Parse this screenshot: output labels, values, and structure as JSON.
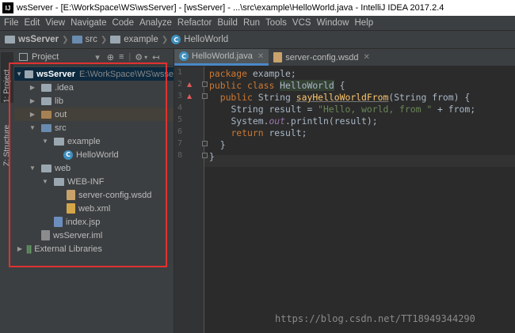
{
  "window": {
    "title": "wsServer - [E:\\WorkSpace\\WS\\wsServer] - [wsServer] - ...\\src\\example\\HelloWorld.java - IntelliJ IDEA 2017.2.4"
  },
  "menu": [
    "File",
    "Edit",
    "View",
    "Navigate",
    "Code",
    "Analyze",
    "Refactor",
    "Build",
    "Run",
    "Tools",
    "VCS",
    "Window",
    "Help"
  ],
  "breadcrumb": {
    "project": "wsServer",
    "folder1": "src",
    "folder2": "example",
    "file": "HelloWorld"
  },
  "side_tabs": {
    "project": "1: Project",
    "structure": "Z: Structure"
  },
  "project_panel": {
    "view_selector": "Project",
    "tree": [
      {
        "label": "wsServer",
        "path": "E:\\WorkSpace\\WS\\wsse"
      },
      {
        "label": ".idea"
      },
      {
        "label": "lib"
      },
      {
        "label": "out"
      },
      {
        "label": "src"
      },
      {
        "label": "example"
      },
      {
        "label": "HelloWorld"
      },
      {
        "label": "web"
      },
      {
        "label": "WEB-INF"
      },
      {
        "label": "server-config.wsdd"
      },
      {
        "label": "web.xml"
      },
      {
        "label": "index.jsp"
      },
      {
        "label": "wsServer.iml"
      },
      {
        "label": "External Libraries"
      }
    ]
  },
  "editor_tabs": [
    {
      "label": "HelloWorld.java",
      "active": true
    },
    {
      "label": "server-config.wsdd",
      "active": false
    }
  ],
  "code": {
    "line_numbers": [
      "1",
      "2",
      "3",
      "4",
      "5",
      "6",
      "7",
      "8"
    ],
    "l1": {
      "kw": "package",
      "rest": " example;"
    },
    "l2": {
      "kw1": "public",
      "kw2": " class ",
      "name": "HelloWorld",
      "rest": " {"
    },
    "l3": {
      "kw1": "public",
      "type": " String ",
      "fn": "sayHelloWorldFrom",
      "rest": "(String from) {"
    },
    "l4": {
      "a": "String result = ",
      "str": "\"Hello, world, from \"",
      "b": " + from;"
    },
    "l5": {
      "a": "System.",
      "static": "out",
      "b": ".println(result);"
    },
    "l6": {
      "kw": "return",
      "rest": " result;"
    },
    "l7": "}",
    "l8": "}"
  },
  "watermark": "https://blog.csdn.net/TT18949344290"
}
